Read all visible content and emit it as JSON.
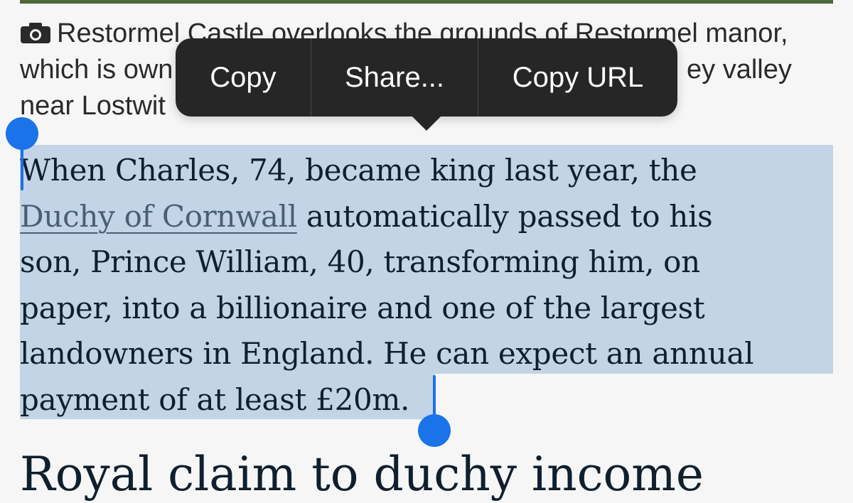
{
  "caption": {
    "icon": "camera-icon",
    "lines": [
      "Restormel Castle overlooks the grounds of Restormel manor,",
      "which is own",
      "near Lostwit"
    ],
    "line2_right": "ey valley"
  },
  "article": {
    "paragraph_lines": [
      "When Charles, 74, became king last year, the",
      " automatically passed to his",
      "son, Prince William, 40, transforming him, on",
      "paper, into a billionaire and one of the largest",
      "landowners in England. He can expect an annual",
      "payment of at least £20m."
    ],
    "link_text": "Duchy of Cornwall",
    "heading": "Royal claim to duchy income"
  },
  "context_menu": {
    "items": [
      "Copy",
      "Share...",
      "Copy URL"
    ]
  },
  "colors": {
    "selection": "#c2d4e6",
    "handle": "#1a73e8",
    "menu_bg": "#262626",
    "link": "#4a5e74"
  }
}
